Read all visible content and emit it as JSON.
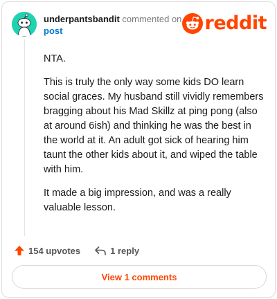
{
  "header": {
    "username": "underpantsbandit",
    "action_text": "commented on",
    "post_link": "post",
    "logo_text": "reddit"
  },
  "comment": {
    "paragraphs": [
      "NTA.",
      "This is truly the only way some kids DO learn social graces. My husband still vividly remembers bragging about his Mad Skillz at ping pong (also at around 6ish) and thinking he was the best in the world at it. An adult got sick of hearing him taunt the other kids about it, and wiped the table with him.",
      "It made a big impression, and was a really valuable lesson."
    ]
  },
  "actions": {
    "upvotes": "154 upvotes",
    "replies": "1 reply"
  },
  "view_button": "View 1 comments",
  "colors": {
    "brand": "#ff4500",
    "link": "#0079d3",
    "avatar": "#1fd3b1"
  }
}
